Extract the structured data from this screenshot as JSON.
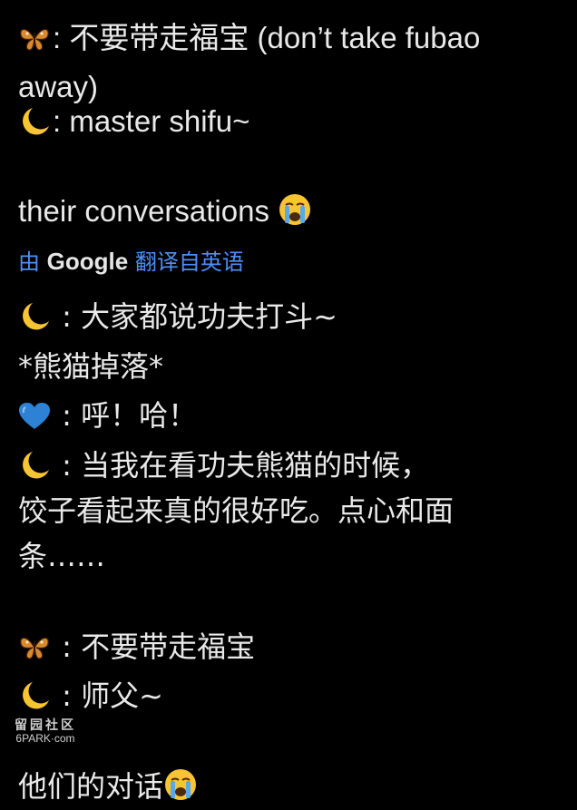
{
  "post": {
    "english": {
      "line1": ": 不要带走福宝 (don’t take fubao away)",
      "line2": ": master shifu~",
      "caption": "their conversations "
    },
    "translation_label": {
      "prefix": "由 ",
      "brand": "Google",
      "suffix": " 翻译自英语"
    },
    "chinese": {
      "line1": " : 大家都说功夫打斗~",
      "line2": "*熊猫掉落*",
      "line3": " :  呼！哈！",
      "line4": " :  当我在看功夫熊猫的时候，",
      "line5": "饺子看起来真的很好吃。点心和面",
      "line6": "条……",
      "line7": " : 不要带走福宝",
      "line8": " : 师父~",
      "caption": "他们的对话"
    }
  },
  "watermark": {
    "cn": "留园社区",
    "en": "6PARK·com"
  },
  "icons": {
    "butterfly": "butterfly-emoji-icon",
    "moon": "crescent-moon-emoji-icon",
    "heart": "blue-heart-emoji-icon",
    "crying": "loudly-crying-face-emoji-icon"
  },
  "colors": {
    "background": "#000000",
    "text": "#e9e9e9",
    "translate_link": "#4e8ff7"
  }
}
